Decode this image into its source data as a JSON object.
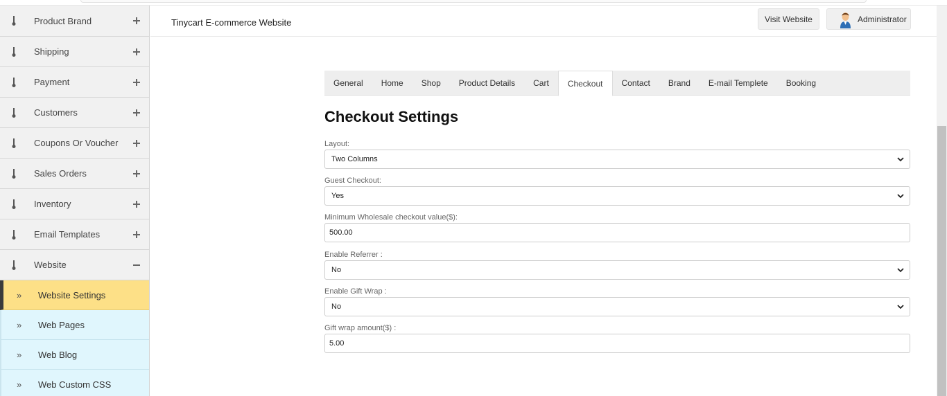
{
  "sidebar": {
    "items": [
      {
        "label": "Product Brand",
        "toggle": "plus"
      },
      {
        "label": "Shipping",
        "toggle": "plus"
      },
      {
        "label": "Payment",
        "toggle": "plus"
      },
      {
        "label": "Customers",
        "toggle": "plus"
      },
      {
        "label": "Coupons Or Voucher",
        "toggle": "plus"
      },
      {
        "label": "Sales Orders",
        "toggle": "plus"
      },
      {
        "label": "Inventory",
        "toggle": "plus"
      },
      {
        "label": "Email Templates",
        "toggle": "plus"
      },
      {
        "label": "Website",
        "toggle": "minus"
      }
    ],
    "sub_items": [
      {
        "label": "Website Settings",
        "icon": "»",
        "active": true
      },
      {
        "label": "Web Pages",
        "icon": "»",
        "active": false
      },
      {
        "label": "Web Blog",
        "icon": "»",
        "active": false
      },
      {
        "label": "Web Custom CSS",
        "icon": "»",
        "active": false
      }
    ]
  },
  "header": {
    "title": "Tinycart E-commerce Website",
    "visit_label": "Visit Website",
    "admin_label": "Administrator"
  },
  "tabs": [
    "General",
    "Home",
    "Shop",
    "Product Details",
    "Cart",
    "Checkout",
    "Contact",
    "Brand",
    "E-mail Templete",
    "Booking"
  ],
  "active_tab": "Checkout",
  "page_title": "Checkout Settings",
  "form": {
    "layout": {
      "label": "Layout:",
      "value": "Two Columns"
    },
    "guest_checkout": {
      "label": "Guest Checkout:",
      "value": "Yes"
    },
    "min_wholesale": {
      "label": "Minimum Wholesale checkout value($):",
      "value": "500.00"
    },
    "enable_referrer": {
      "label": "Enable Referrer :",
      "value": "No"
    },
    "enable_gift_wrap": {
      "label": "Enable Gift Wrap :",
      "value": "No"
    },
    "gift_wrap_amount": {
      "label": "Gift wrap amount($) :",
      "value": "5.00"
    }
  },
  "colors": {
    "sidebar_bg": "#f1f1f1",
    "sub_item_bg": "#e0f6fd",
    "active_sub_bg": "#fde087",
    "tab_bar_bg": "#eeeeee"
  }
}
